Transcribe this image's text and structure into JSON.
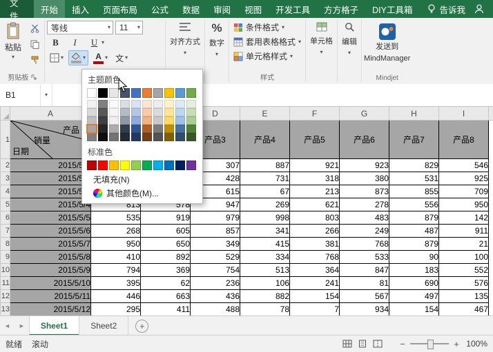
{
  "colors": {
    "accent_green": "#217346",
    "header_fill": "#A6A6A6",
    "grid_border": "#000000"
  },
  "tab_bar": {
    "file": "文件",
    "tabs": [
      "开始",
      "插入",
      "页面布局",
      "公式",
      "数据",
      "审阅",
      "视图",
      "开发工具",
      "方方格子",
      "DIY工具箱"
    ],
    "active_tab": "开始",
    "tell_me": "告诉我"
  },
  "ribbon": {
    "clipboard": {
      "paste_label": "粘贴",
      "group_label": "剪贴板"
    },
    "font": {
      "font_name": "等线",
      "font_size": "11",
      "bold_label": "B",
      "italic_label": "I",
      "underline_label": "U",
      "phonetic_glyph": "文",
      "font_color_bar": "#c00000",
      "fill_color_bar": "#a6a6a6"
    },
    "alignment_label": "对齐方式",
    "number": {
      "label": "数字",
      "icon_glyph": "%"
    },
    "styles": {
      "conditional_label": "条件格式",
      "table_format_label": "套用表格格式",
      "cell_styles_label": "单元格样式",
      "group_label": "样式"
    },
    "cells_label": "单元格",
    "editing_label": "编辑",
    "mindjet": {
      "line1": "发送到",
      "line2": "MindManager",
      "group_label": "Mindjet"
    }
  },
  "color_picker": {
    "theme_section_label": "主题颜色",
    "standard_section_label": "标准色",
    "no_fill_label": "无填充(N)",
    "more_colors_label": "其他颜色(M)...",
    "theme_colors": [
      "#FFFFFF",
      "#000000",
      "#E7E6E6",
      "#44546A",
      "#4472C4",
      "#ED7D31",
      "#A5A5A5",
      "#FFC000",
      "#5B9BD5",
      "#70AD47"
    ],
    "standard_colors": [
      "#C00000",
      "#FF0000",
      "#FFC000",
      "#FFFF00",
      "#92D050",
      "#00B050",
      "#00B0F0",
      "#0070C0",
      "#002060",
      "#7030A0"
    ],
    "selected_swatch": {
      "column": 0,
      "variant_row": 3
    }
  },
  "formula_bar": {
    "name_box": "B1"
  },
  "grid": {
    "column_letters": [
      "A",
      "B",
      "C",
      "D",
      "E",
      "F",
      "G",
      "H",
      "I"
    ],
    "header_row_number": "1",
    "diagonal_header": {
      "top_right": "产品",
      "middle": "销量",
      "bottom_left": "日期"
    },
    "product_headers": [
      null,
      null,
      "产品3",
      "产品4",
      "产品5",
      "产品6",
      "产品7",
      "产品8"
    ],
    "rows": [
      {
        "row": 2,
        "date": "2015/5/1",
        "values": [
          null,
          null,
          307,
          887,
          921,
          923,
          829,
          546
        ]
      },
      {
        "row": 3,
        "date": "2015/5/2",
        "values": [
          null,
          null,
          428,
          731,
          318,
          380,
          531,
          925
        ]
      },
      {
        "row": 4,
        "date": "2015/5/3",
        "values": [
          null,
          null,
          615,
          67,
          213,
          873,
          855,
          709
        ]
      },
      {
        "row": 5,
        "date": "2015/5/4",
        "values": [
          813,
          578,
          947,
          269,
          621,
          278,
          556,
          950
        ]
      },
      {
        "row": 6,
        "date": "2015/5/5",
        "values": [
          535,
          919,
          979,
          998,
          803,
          483,
          879,
          142
        ]
      },
      {
        "row": 7,
        "date": "2015/5/6",
        "values": [
          268,
          605,
          857,
          341,
          266,
          249,
          487,
          911
        ]
      },
      {
        "row": 8,
        "date": "2015/5/7",
        "values": [
          950,
          650,
          349,
          415,
          381,
          768,
          879,
          21
        ]
      },
      {
        "row": 9,
        "date": "2015/5/8",
        "values": [
          410,
          892,
          529,
          334,
          768,
          533,
          90,
          100
        ]
      },
      {
        "row": 10,
        "date": "2015/5/9",
        "values": [
          794,
          369,
          754,
          513,
          364,
          847,
          183,
          552
        ]
      },
      {
        "row": 11,
        "date": "2015/5/10",
        "values": [
          395,
          62,
          236,
          106,
          241,
          81,
          690,
          576
        ]
      },
      {
        "row": 12,
        "date": "2015/5/11",
        "values": [
          446,
          663,
          436,
          882,
          154,
          567,
          497,
          135
        ]
      },
      {
        "row": 13,
        "date": "2015/5/12",
        "values": [
          295,
          411,
          488,
          78,
          7,
          934,
          154,
          467
        ]
      }
    ]
  },
  "sheet_tab_bar": {
    "tabs": [
      {
        "label": "Sheet1",
        "active": true
      },
      {
        "label": "Sheet2",
        "active": false
      }
    ]
  },
  "status_bar": {
    "left": [
      "就绪",
      "滚动"
    ],
    "zoom_level": "100%"
  }
}
